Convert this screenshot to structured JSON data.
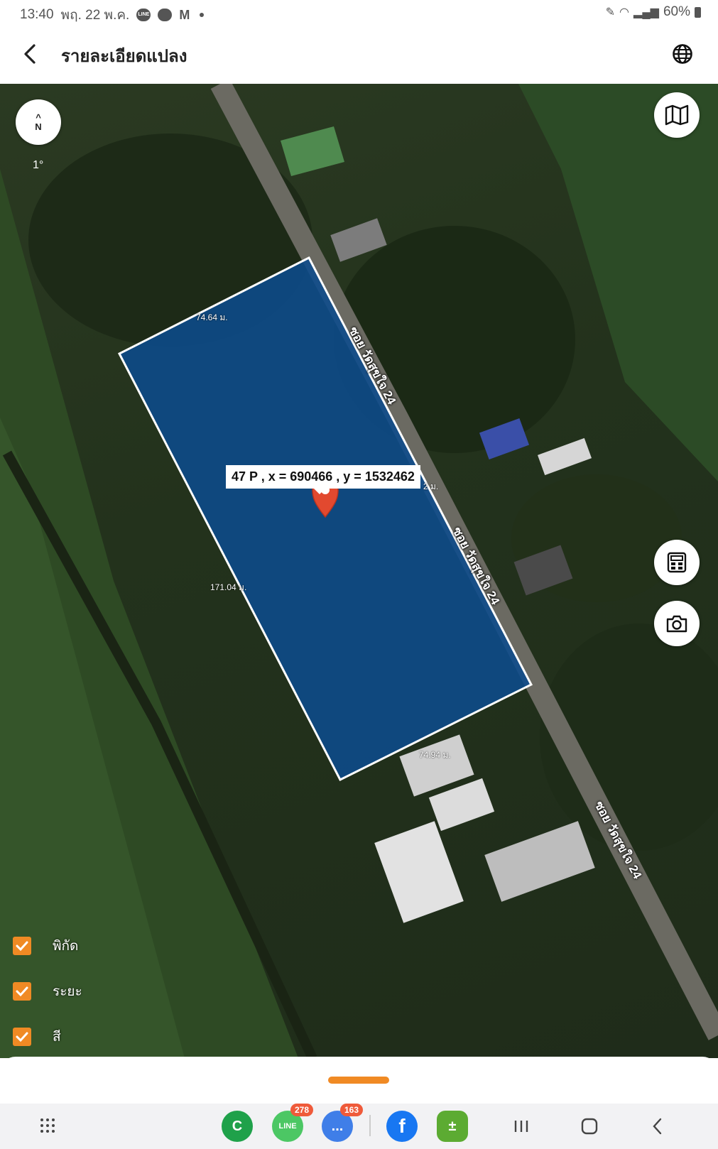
{
  "status_bar": {
    "time": "13:40",
    "date": "พฤ. 22 พ.ค.",
    "notifications": [
      "line-icon",
      "chat-icon",
      "gmail-icon"
    ],
    "battery": "60%"
  },
  "header": {
    "title": "รายละเอียดแปลง",
    "back_icon": "back-arrow-icon",
    "language_icon": "globe-icon"
  },
  "map": {
    "compass_label": "N",
    "compass_deg": "1°",
    "parcel_label": "47 P , x = 690466 , y = 1532462",
    "parcel_color": "#0d4b8c",
    "distances": {
      "top": "74.64 ม.",
      "left": "171.04 ม.",
      "right": "2 ม.",
      "bottom": "74.94 ม."
    },
    "road_labels": [
      "ซอย วัดสุขใจ 24",
      "ซอย วัดสุขใจ 24",
      "ซอย วัดสุขใจ 24"
    ]
  },
  "layers": [
    {
      "label": "พิกัด",
      "checked": true
    },
    {
      "label": "ระยะ",
      "checked": true
    },
    {
      "label": "สี",
      "checked": true
    }
  ],
  "bottom_nav": {
    "apps": [
      {
        "name": "phone-app",
        "letter": "C",
        "color": "#1fa14a"
      },
      {
        "name": "line-app",
        "letter": "LINE",
        "color": "#4cc764",
        "badge": "278"
      },
      {
        "name": "messages-app",
        "letter": "...",
        "color": "#3f7ee8",
        "badge": "163"
      },
      {
        "name": "facebook-app",
        "letter": "f",
        "color": "#1877f2"
      },
      {
        "name": "calculator-app",
        "letter": "±",
        "color": "#5cab32"
      }
    ]
  },
  "accent_color": "#f08a24"
}
